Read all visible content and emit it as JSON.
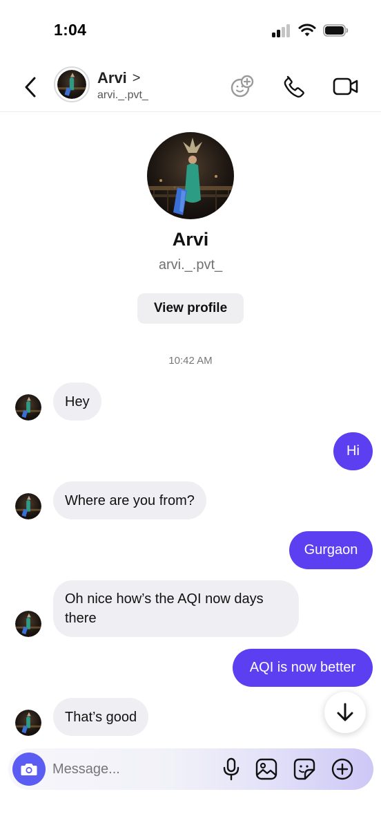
{
  "status_bar": {
    "time": "1:04"
  },
  "header": {
    "name": "Arvi",
    "chevron": ">",
    "handle": "arvi._.pvt_"
  },
  "profile": {
    "name": "Arvi",
    "handle": "arvi._.pvt_",
    "view_profile_label": "View profile"
  },
  "thread": {
    "timestamp": "10:42 AM",
    "messages": [
      {
        "from": "them",
        "text": "Hey"
      },
      {
        "from": "me",
        "text": "Hi"
      },
      {
        "from": "them",
        "text": "Where are you from?"
      },
      {
        "from": "me",
        "text": "Gurgaon"
      },
      {
        "from": "them",
        "text": "Oh nice how’s the AQI now days there"
      },
      {
        "from": "me",
        "text": "AQI is now better"
      },
      {
        "from": "them",
        "text": "That’s good"
      }
    ]
  },
  "composer": {
    "placeholder": "Message...",
    "icons": [
      "camera-icon",
      "microphone-icon",
      "gallery-icon",
      "sticker-icon",
      "add-icon"
    ]
  },
  "colors": {
    "outgoing_bubble": "#5b3ff0",
    "incoming_bubble": "#efeff3",
    "camera_button": "#5b5cf2"
  }
}
